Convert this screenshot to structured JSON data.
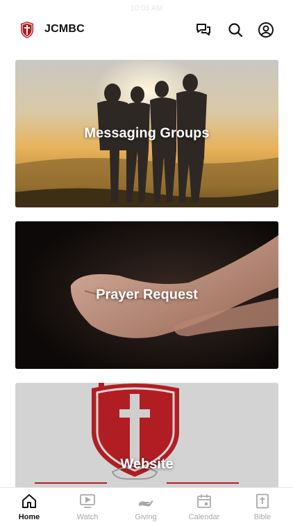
{
  "status": {
    "time": "10:03 AM"
  },
  "header": {
    "title": "JCMBC",
    "icons": [
      "church-shield-logo",
      "chat-icon",
      "search-icon",
      "user-icon"
    ]
  },
  "cards": [
    {
      "label": "Messaging Groups"
    },
    {
      "label": "Prayer Request"
    },
    {
      "label": "Website"
    }
  ],
  "tabs": [
    {
      "label": "Home",
      "icon": "home-icon",
      "active": true
    },
    {
      "label": "Watch",
      "icon": "watch-icon",
      "active": false
    },
    {
      "label": "Giving",
      "icon": "giving-icon",
      "active": false
    },
    {
      "label": "Calendar",
      "icon": "calendar-icon",
      "active": false
    },
    {
      "label": "Bible",
      "icon": "bible-icon",
      "active": false
    }
  ],
  "colors": {
    "brand_red": "#b01e24",
    "active_tab": "#111111",
    "inactive_tab": "#a9a9a9"
  }
}
